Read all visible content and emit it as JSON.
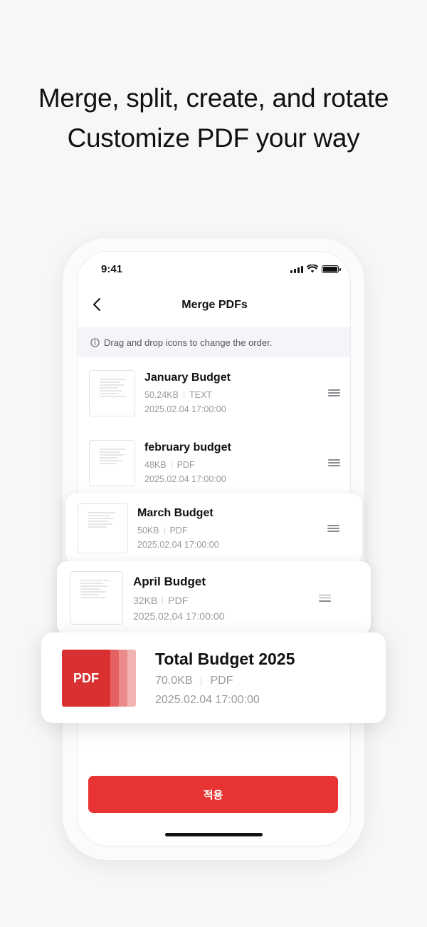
{
  "headline": {
    "line1": "Merge, split, create, and rotate",
    "line2": "Customize PDF your way"
  },
  "status_bar": {
    "time": "9:41"
  },
  "nav": {
    "title": "Merge PDFs"
  },
  "info": {
    "text": "Drag and drop icons to change the order."
  },
  "files": [
    {
      "name": "January Budget",
      "size": "50.24KB",
      "type": "TEXT",
      "date": "2025.02.04 17:00:00"
    },
    {
      "name": "february budget",
      "size": "48KB",
      "type": "PDF",
      "date": "2025.02.04 17:00:00"
    },
    {
      "name": "March Budget",
      "size": "50KB",
      "type": "PDF",
      "date": "2025.02.04 17:00:00"
    },
    {
      "name": "April Budget",
      "size": "32KB",
      "type": "PDF",
      "date": "2025.02.04 17:00:00"
    }
  ],
  "result": {
    "name": "Total Budget 2025",
    "size": "70.0KB",
    "type": "PDF",
    "date": "2025.02.04 17:00:00",
    "icon_label": "PDF"
  },
  "apply_label": "적용",
  "colors": {
    "accent": "#e83434",
    "pdf_icon": "#d93131"
  }
}
